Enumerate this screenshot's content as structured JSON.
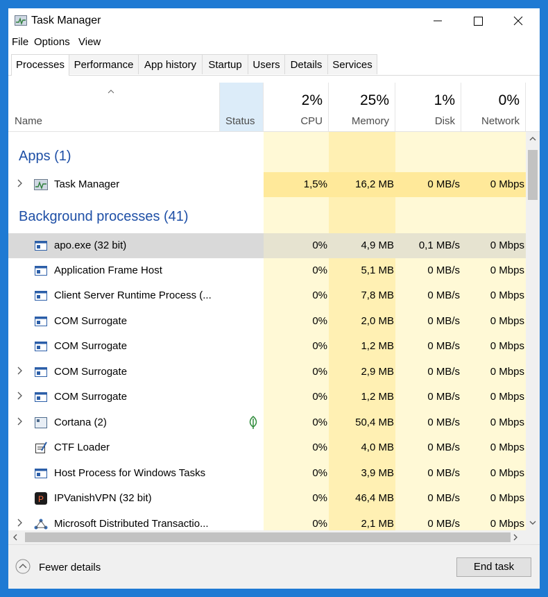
{
  "window": {
    "title": "Task Manager"
  },
  "menu": {
    "file": "File",
    "options": "Options",
    "view": "View"
  },
  "tabs": [
    "Processes",
    "Performance",
    "App history",
    "Startup",
    "Users",
    "Details",
    "Services"
  ],
  "columns": {
    "name": "Name",
    "status": "Status",
    "cpu": {
      "pct": "2%",
      "label": "CPU"
    },
    "memory": {
      "pct": "25%",
      "label": "Memory"
    },
    "disk": {
      "pct": "1%",
      "label": "Disk"
    },
    "network": {
      "pct": "0%",
      "label": "Network"
    }
  },
  "groups": {
    "apps": "Apps (1)",
    "background": "Background processes (41)"
  },
  "apps": [
    {
      "name": "Task Manager",
      "cpu": "1,5%",
      "memory": "16,2 MB",
      "disk": "0 MB/s",
      "network": "0 Mbps"
    }
  ],
  "processes": [
    {
      "name": "apo.exe (32 bit)",
      "cpu": "0%",
      "memory": "4,9 MB",
      "disk": "0,1 MB/s",
      "network": "0 Mbps"
    },
    {
      "name": "Application Frame Host",
      "cpu": "0%",
      "memory": "5,1 MB",
      "disk": "0 MB/s",
      "network": "0 Mbps"
    },
    {
      "name": "Client Server Runtime Process (...",
      "cpu": "0%",
      "memory": "7,8 MB",
      "disk": "0 MB/s",
      "network": "0 Mbps"
    },
    {
      "name": "COM Surrogate",
      "cpu": "0%",
      "memory": "2,0 MB",
      "disk": "0 MB/s",
      "network": "0 Mbps"
    },
    {
      "name": "COM Surrogate",
      "cpu": "0%",
      "memory": "1,2 MB",
      "disk": "0 MB/s",
      "network": "0 Mbps"
    },
    {
      "name": "COM Surrogate",
      "cpu": "0%",
      "memory": "2,9 MB",
      "disk": "0 MB/s",
      "network": "0 Mbps"
    },
    {
      "name": "COM Surrogate",
      "cpu": "0%",
      "memory": "1,2 MB",
      "disk": "0 MB/s",
      "network": "0 Mbps"
    },
    {
      "name": "Cortana (2)",
      "cpu": "0%",
      "memory": "50,4 MB",
      "disk": "0 MB/s",
      "network": "0 Mbps"
    },
    {
      "name": "CTF Loader",
      "cpu": "0%",
      "memory": "4,0 MB",
      "disk": "0 MB/s",
      "network": "0 Mbps"
    },
    {
      "name": "Host Process for Windows Tasks",
      "cpu": "0%",
      "memory": "3,9 MB",
      "disk": "0 MB/s",
      "network": "0 Mbps"
    },
    {
      "name": "IPVanishVPN (32 bit)",
      "cpu": "0%",
      "memory": "46,4 MB",
      "disk": "0 MB/s",
      "network": "0 Mbps"
    },
    {
      "name": "Microsoft Distributed Transactio...",
      "cpu": "0%",
      "memory": "2,1 MB",
      "disk": "0 MB/s",
      "network": "0 Mbps"
    }
  ],
  "footer": {
    "fewer_details": "Fewer details",
    "end_task": "End task"
  },
  "colors": {
    "heat_light": "#fff9d6",
    "heat_mid": "#fff0b3",
    "heat_strong": "#ffe99a",
    "group_blue": "#1e4fa6",
    "selected": "#d9d9d9"
  }
}
